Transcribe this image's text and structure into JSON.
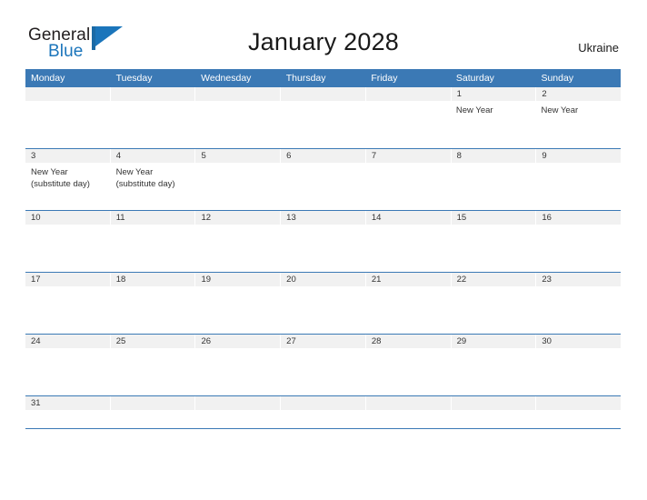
{
  "brand": {
    "name_part1": "General",
    "name_part2": "Blue",
    "mark_icon": "flag-triangle-icon",
    "accent_color": "#1b75bb"
  },
  "header": {
    "title": "January 2028",
    "country": "Ukraine",
    "header_bg_color": "#3b79b5",
    "date_strip_color": "#f1f1f1"
  },
  "calendar": {
    "weekdays": [
      "Monday",
      "Tuesday",
      "Wednesday",
      "Thursday",
      "Friday",
      "Saturday",
      "Sunday"
    ],
    "weeks": [
      {
        "dates": [
          "",
          "",
          "",
          "",
          "",
          "1",
          "2"
        ],
        "events": [
          [],
          [],
          [],
          [],
          [],
          [
            "New Year"
          ],
          [
            "New Year"
          ]
        ]
      },
      {
        "dates": [
          "3",
          "4",
          "5",
          "6",
          "7",
          "8",
          "9"
        ],
        "events": [
          [
            "New Year",
            "(substitute day)"
          ],
          [
            "New Year",
            "(substitute day)"
          ],
          [],
          [],
          [],
          [],
          []
        ]
      },
      {
        "dates": [
          "10",
          "11",
          "12",
          "13",
          "14",
          "15",
          "16"
        ],
        "events": [
          [],
          [],
          [],
          [],
          [],
          [],
          []
        ]
      },
      {
        "dates": [
          "17",
          "18",
          "19",
          "20",
          "21",
          "22",
          "23"
        ],
        "events": [
          [],
          [],
          [],
          [],
          [],
          [],
          []
        ]
      },
      {
        "dates": [
          "24",
          "25",
          "26",
          "27",
          "28",
          "29",
          "30"
        ],
        "events": [
          [],
          [],
          [],
          [],
          [],
          [],
          []
        ]
      },
      {
        "dates": [
          "31",
          "",
          "",
          "",
          "",
          "",
          ""
        ],
        "events": [
          [],
          [],
          [],
          [],
          [],
          [],
          []
        ]
      }
    ]
  }
}
